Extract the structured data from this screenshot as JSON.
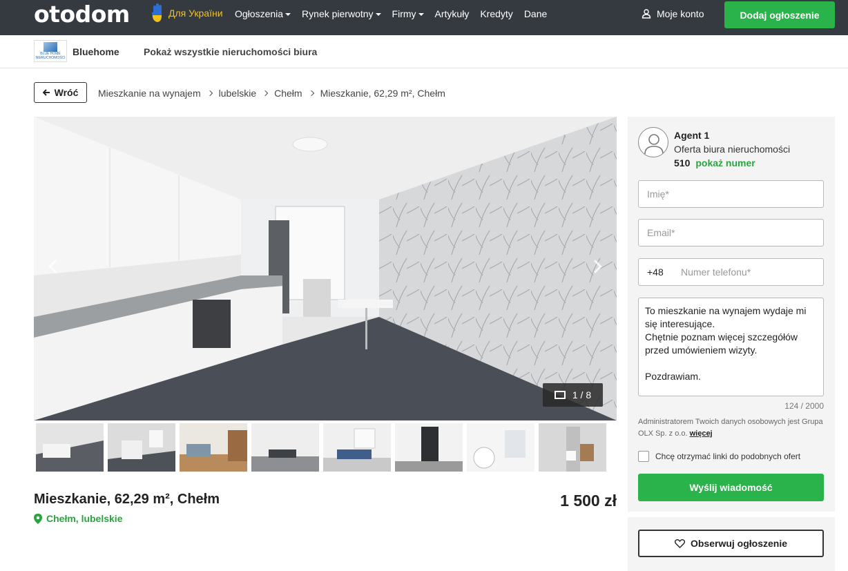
{
  "header": {
    "logo_text": "otodom",
    "ukraine_label": "Для України",
    "nav": [
      {
        "label": "Ogłoszenia",
        "dropdown": true
      },
      {
        "label": "Rynek pierwotny",
        "dropdown": true
      },
      {
        "label": "Firmy",
        "dropdown": true
      },
      {
        "label": "Artykuły",
        "dropdown": false
      },
      {
        "label": "Kredyty",
        "dropdown": false
      },
      {
        "label": "Dane",
        "dropdown": false
      }
    ],
    "account_label": "Moje konto",
    "add_button": "Dodaj ogłoszenie",
    "accent_color": "#29b34a"
  },
  "agency": {
    "logo_text": "BLUE HOME NIERUCHOMOŚCI",
    "name": "Bluehome",
    "all_listings_link": "Pokaż wszystkie nieruchomości biura"
  },
  "breadcrumb": {
    "back_label": "Wróć",
    "items": [
      "Mieszkanie na wynajem",
      "lubelskie",
      "Chełm",
      "Mieszkanie, 62,29 m², Chełm"
    ]
  },
  "gallery": {
    "counter": "1 / 8",
    "thumbnail_count": 8
  },
  "listing": {
    "title": "Mieszkanie, 62,29 m², Chełm",
    "location": "Chełm, lubelskie",
    "price": "1 500 zł"
  },
  "contact": {
    "agent_name": "Agent 1",
    "agent_office": "Oferta biura nieruchomości",
    "phone_prefix_partial": "510",
    "show_number": "pokaż numer",
    "name_placeholder": "Imię*",
    "email_placeholder": "Email*",
    "phone_country_code": "+48",
    "phone_placeholder": "Numer telefonu*",
    "message": "To mieszkanie na wynajem wydaje mi się interesujące.\nChętnie poznam więcej szczegółów przed umówieniem wizyty.\n\nPozdrawiam.",
    "char_count": "124 / 2000",
    "gdpr_text": "Administratorem Twoich danych osobowych jest Grupa OLX Sp. z o.o. ",
    "gdpr_more": "więcej",
    "checkbox_label": "Chcę otrzymać linki do podobnych ofert",
    "send_button": "Wyślij wiadomość",
    "observe_button": "Obserwuj ogłoszenie"
  }
}
